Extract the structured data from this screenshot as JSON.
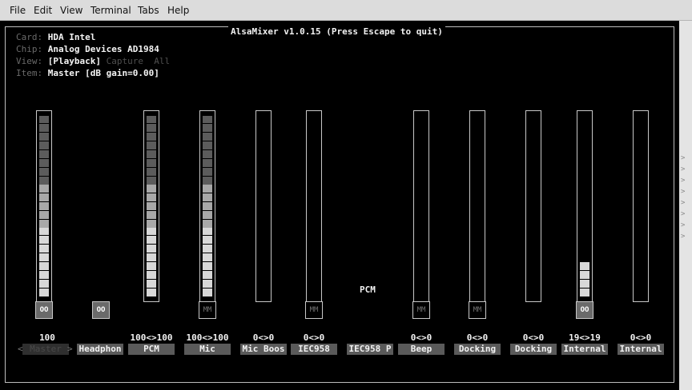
{
  "menu": {
    "file": "File",
    "edit": "Edit",
    "view": "View",
    "terminal": "Terminal",
    "tabs": "Tabs",
    "help": "Help"
  },
  "mixer": {
    "title": "AlsaMixer v1.0.15 (Press Escape to quit)",
    "card_label": "Card:",
    "card_value": "HDA Intel",
    "chip_label": "Chip:",
    "chip_value": "Analog Devices AD1984",
    "view_label": "View:",
    "view_playback": "[Playback]",
    "view_capture": "Capture",
    "view_all": "All",
    "item_label": "Item:",
    "item_value": "Master [dB gain=0.00]",
    "pcm_label": "PCM",
    "sel_left": "<",
    "sel_right": ">",
    "scroll_arrow": ">"
  },
  "controls": [
    {
      "name": "Master",
      "volume": "100",
      "level": 100,
      "switch": "OO",
      "selected": true
    },
    {
      "name": "Headphon",
      "volume": "",
      "level": null,
      "switch": "OO",
      "selected": false
    },
    {
      "name": "PCM",
      "volume": "100<>100",
      "level": 100,
      "switch": "",
      "selected": false
    },
    {
      "name": "Mic",
      "volume": "100<>100",
      "level": 100,
      "switch": "MM",
      "selected": false
    },
    {
      "name": "Mic Boos",
      "volume": "0<>0",
      "level": 0,
      "switch": "",
      "selected": false
    },
    {
      "name": "IEC958",
      "volume": "0<>0",
      "level": 0,
      "switch": "MM",
      "selected": false
    },
    {
      "name": "IEC958 P",
      "volume": "",
      "level": null,
      "switch": "",
      "selected": false
    },
    {
      "name": "Beep",
      "volume": "0<>0",
      "level": 0,
      "switch": "MM",
      "selected": false
    },
    {
      "name": "Docking",
      "volume": "0<>0",
      "level": 0,
      "switch": "MM",
      "selected": false
    },
    {
      "name": "Docking",
      "volume": "0<>0",
      "level": 0,
      "switch": "",
      "selected": false
    },
    {
      "name": "Internal",
      "volume": "19<>19",
      "level": 19,
      "switch": "OO",
      "selected": false
    },
    {
      "name": "Internal",
      "volume": "0<>0",
      "level": 0,
      "switch": "",
      "selected": false
    }
  ]
}
